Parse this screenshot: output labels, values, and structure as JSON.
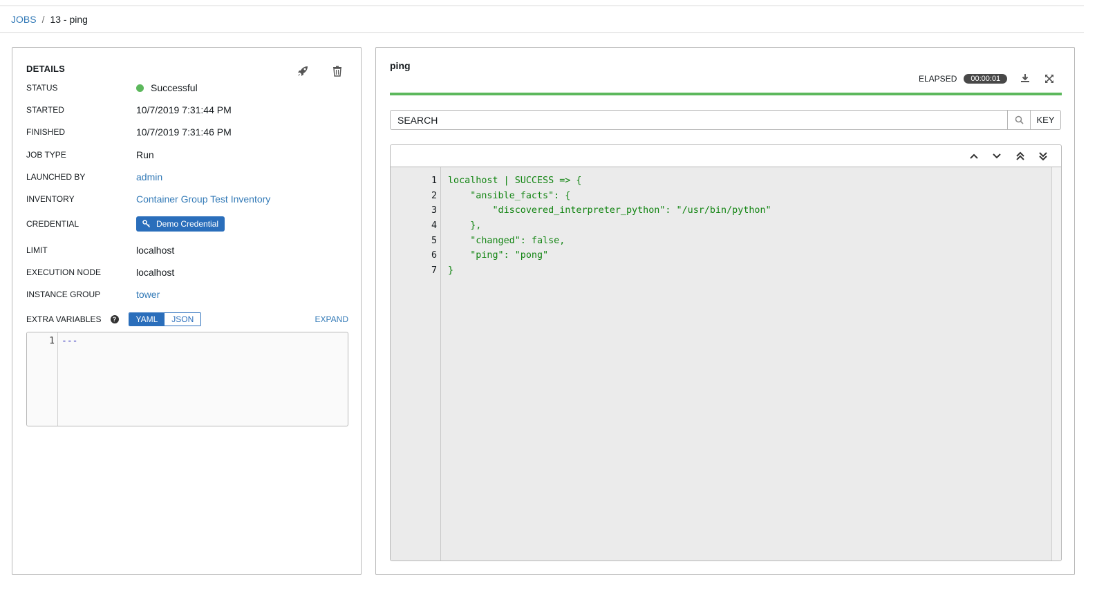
{
  "breadcrumb": {
    "root": "JOBS",
    "separator": "/",
    "current": "13 - ping"
  },
  "details": {
    "title": "DETAILS",
    "rows": [
      {
        "label": "STATUS",
        "value": "Successful",
        "status_color": "#5cb85c"
      },
      {
        "label": "STARTED",
        "value": "10/7/2019 7:31:44 PM"
      },
      {
        "label": "FINISHED",
        "value": "10/7/2019 7:31:46 PM"
      },
      {
        "label": "JOB TYPE",
        "value": "Run"
      },
      {
        "label": "LAUNCHED BY",
        "value": "admin"
      },
      {
        "label": "INVENTORY",
        "value": "Container Group Test Inventory"
      },
      {
        "label": "CREDENTIAL",
        "value": "Demo Credential"
      },
      {
        "label": "LIMIT",
        "value": "localhost"
      },
      {
        "label": "EXECUTION NODE",
        "value": "localhost"
      },
      {
        "label": "INSTANCE GROUP",
        "value": "tower"
      }
    ],
    "extra_vars": {
      "label": "EXTRA VARIABLES",
      "yaml_label": "YAML",
      "json_label": "JSON",
      "active": "YAML",
      "expand_label": "EXPAND",
      "line_number": "1",
      "code": "---"
    },
    "icons": [
      "rocket-icon",
      "trash-icon",
      "question-circle-icon",
      "key-icon"
    ]
  },
  "output": {
    "title": "ping",
    "elapsed_label": "ELAPSED",
    "elapsed_value": "00:00:01",
    "progress_percent": 100,
    "progress_color": "#5cb85c",
    "search_placeholder": "SEARCH",
    "key_label": "KEY",
    "lines": [
      {
        "n": "1",
        "text": "localhost | SUCCESS => {"
      },
      {
        "n": "2",
        "text": "    \"ansible_facts\": {"
      },
      {
        "n": "3",
        "text": "        \"discovered_interpreter_python\": \"/usr/bin/python\""
      },
      {
        "n": "4",
        "text": "    },"
      },
      {
        "n": "5",
        "text": "    \"changed\": false,"
      },
      {
        "n": "6",
        "text": "    \"ping\": \"pong\""
      },
      {
        "n": "7",
        "text": "}"
      }
    ],
    "text_color": "#118411",
    "icons": [
      "download-icon",
      "fullscreen-icon",
      "search-icon",
      "chevron-up-icon",
      "chevron-down-icon",
      "double-chevron-up-icon",
      "double-chevron-down-icon"
    ]
  },
  "colors": {
    "link": "#337ab7",
    "accent": "#2a6ebb",
    "success": "#5cb85c"
  }
}
